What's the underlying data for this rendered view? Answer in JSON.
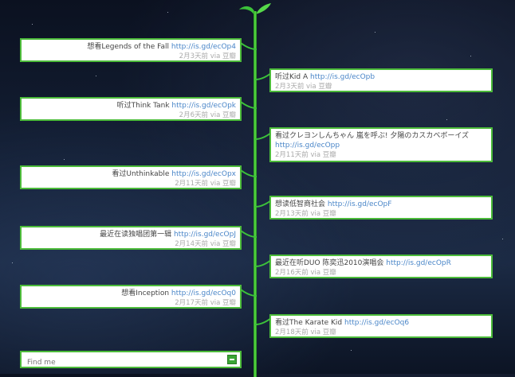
{
  "search": {
    "placeholder": "Find me"
  },
  "left_items": [
    {
      "text": "想看Legends of the Fall",
      "link": "http://is.gd/ecOp4",
      "time": "2月3天前",
      "via": "via 豆瓣"
    },
    {
      "text": "听过Think Tank",
      "link": "http://is.gd/ecOpk",
      "time": "2月6天前",
      "via": "via 豆瓣"
    },
    {
      "text": "看过Unthinkable",
      "link": "http://is.gd/ecOpx",
      "time": "2月11天前",
      "via": "via 豆瓣"
    },
    {
      "text": "最近在读独唱团第一辑",
      "link": "http://is.gd/ecOpJ",
      "time": "2月14天前",
      "via": "via 豆瓣"
    },
    {
      "text": "想看Inception",
      "link": "http://is.gd/ecOq0",
      "time": "2月17天前",
      "via": "via 豆瓣"
    }
  ],
  "right_items": [
    {
      "text": "听过Kid A",
      "link": "http://is.gd/ecOpb",
      "time": "2月3天前",
      "via": "via 豆瓣"
    },
    {
      "text": "看过クレヨンしんちゃん 嵐を呼ぶ! 夕陽のカスカベボーイズ",
      "link": "http://is.gd/ecOpp",
      "time": "2月11天前",
      "via": "via 豆瓣"
    },
    {
      "text": "想读低智商社会",
      "link": "http://is.gd/ecOpF",
      "time": "2月13天前",
      "via": "via 豆瓣"
    },
    {
      "text": "最近在听DUO 陈奕迅2010演唱会",
      "link": "http://is.gd/ecOpR",
      "time": "2月16天前",
      "via": "via 豆瓣"
    },
    {
      "text": "看过The Karate Kid",
      "link": "http://is.gd/ecOq6",
      "time": "2月18天前",
      "via": "via 豆瓣"
    }
  ],
  "colors": {
    "accent": "#4cbb3a",
    "link": "#4a86c8",
    "meta": "#aaaaaa"
  }
}
